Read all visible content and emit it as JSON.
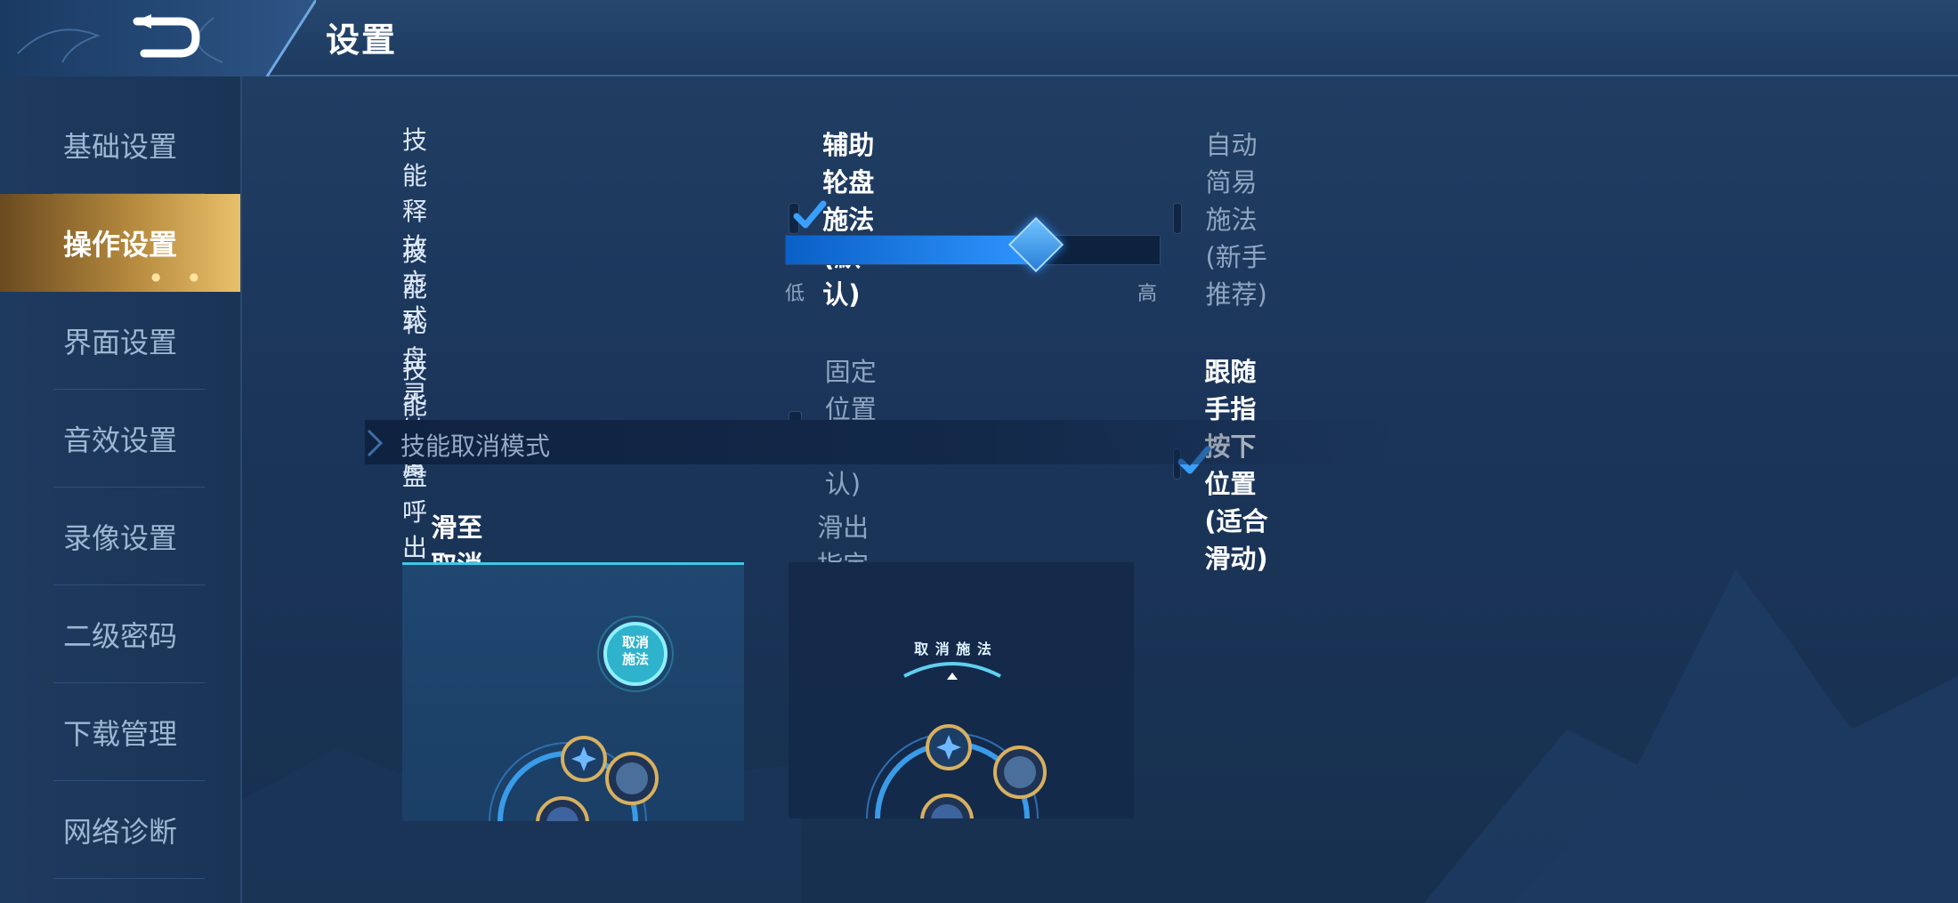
{
  "header": {
    "title": "设置",
    "back_icon": "back-arrow-icon"
  },
  "sidebar": {
    "items": [
      {
        "label": "基础设置",
        "active": false
      },
      {
        "label": "操作设置",
        "active": true
      },
      {
        "label": "界面设置",
        "active": false
      },
      {
        "label": "音效设置",
        "active": false
      },
      {
        "label": "录像设置",
        "active": false
      },
      {
        "label": "二级密码",
        "active": false
      },
      {
        "label": "下载管理",
        "active": false
      },
      {
        "label": "网络诊断",
        "active": false
      }
    ]
  },
  "settings": {
    "cast_mode": {
      "label": "技能释放方式",
      "options": [
        {
          "label": "辅助轮盘施法(默认)",
          "checked": true
        },
        {
          "label": "自动简易施法(新手推荐)",
          "checked": false
        }
      ]
    },
    "sensitivity": {
      "label": "技能轮盘灵敏度",
      "low": "低",
      "high": "高",
      "value_fraction": 0.67
    },
    "wheel_position": {
      "label": "技能轮盘呼出位置",
      "options": [
        {
          "label": "固定位置(默认)",
          "checked": false
        },
        {
          "label": "跟随手指按下位置(适合滑动)",
          "checked": true
        }
      ]
    },
    "cancel_section": {
      "title": "技能取消模式",
      "options": [
        {
          "label": "滑至取消按钮(默认)",
          "checked": true
        },
        {
          "label": "滑出指定距离(高级)",
          "checked": false
        }
      ],
      "preview1_button_line1": "取消",
      "preview1_button_line2": "施法",
      "preview2_arc_text": "取 消 施 法"
    }
  },
  "colors": {
    "accent_blue": "#2f95ff",
    "active_tab_gold": "#e9c06a",
    "check_blue": "#3aa0ff"
  }
}
